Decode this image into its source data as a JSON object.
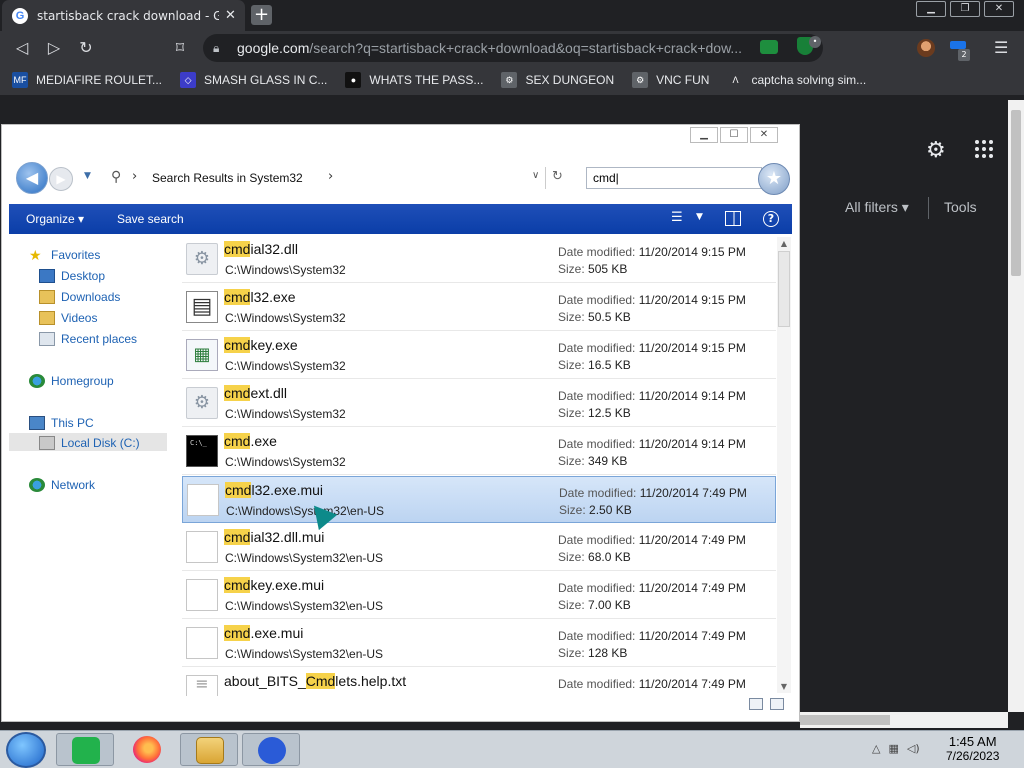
{
  "browser": {
    "tab_title": "startisback crack download - Goog",
    "url_host": "google.com",
    "url_path": "/search?q=startisback+crack+download&oq=startisback+crack+dow...",
    "extension_badge": "2",
    "bookmarks": [
      {
        "label": "MEDIAFIRE ROULET...",
        "icon": "MF",
        "color": "#1a4fa0"
      },
      {
        "label": "SMASH GLASS IN C...",
        "icon": "◇",
        "color": "#3c3cc8"
      },
      {
        "label": "WHATS THE PASS...",
        "icon": "●",
        "color": "#111111"
      },
      {
        "label": "SEX DUNGEON",
        "icon": "⚙",
        "color": "#5f6368"
      },
      {
        "label": "VNC FUN",
        "icon": "⚙",
        "color": "#5f6368"
      },
      {
        "label": "captcha solving sim...",
        "icon": "Λ",
        "color": "#35363a"
      }
    ]
  },
  "google": {
    "all_filters": "All filters ▾",
    "tools": "Tools"
  },
  "explorer": {
    "breadcrumb": "Search Results in System32",
    "search_value": "cmd",
    "toolbar": {
      "organize": "Organize ▾",
      "save_search": "Save search"
    },
    "nav": {
      "favorites": "Favorites",
      "desktop": "Desktop",
      "downloads": "Downloads",
      "videos": "Videos",
      "recent_places": "Recent places",
      "homegroup": "Homegroup",
      "this_pc": "This PC",
      "local_disk": "Local Disk (C:)",
      "network": "Network"
    },
    "labels": {
      "date_modified": "Date modified:",
      "size": "Size:"
    },
    "files": [
      {
        "hl": "cmd",
        "rest": "ial32.dll",
        "path": "C:\\Windows\\System32",
        "date": "11/20/2014 9:15 PM",
        "size": "505 KB",
        "icon": "dll"
      },
      {
        "hl": "cmd",
        "rest": "l32.exe",
        "path": "C:\\Windows\\System32",
        "date": "11/20/2014 9:15 PM",
        "size": "50.5 KB",
        "icon": "cmdl"
      },
      {
        "hl": "cmd",
        "rest": "key.exe",
        "path": "C:\\Windows\\System32",
        "date": "11/20/2014 9:15 PM",
        "size": "16.5 KB",
        "icon": "key"
      },
      {
        "hl": "cmd",
        "rest": "ext.dll",
        "path": "C:\\Windows\\System32",
        "date": "11/20/2014 9:14 PM",
        "size": "12.5 KB",
        "icon": "dll"
      },
      {
        "hl": "cmd",
        "rest": ".exe",
        "path": "C:\\Windows\\System32",
        "date": "11/20/2014 9:14 PM",
        "size": "349 KB",
        "icon": "cmd"
      },
      {
        "hl": "cmd",
        "rest": "l32.exe.mui",
        "path": "C:\\Windows\\System32\\en-US",
        "date": "11/20/2014 7:49 PM",
        "size": "2.50 KB",
        "icon": "doc",
        "selected": true
      },
      {
        "hl": "cmd",
        "rest": "ial32.dll.mui",
        "path": "C:\\Windows\\System32\\en-US",
        "date": "11/20/2014 7:49 PM",
        "size": "68.0 KB",
        "icon": "doc"
      },
      {
        "hl": "cmd",
        "rest": "key.exe.mui",
        "path": "C:\\Windows\\System32\\en-US",
        "date": "11/20/2014 7:49 PM",
        "size": "7.00 KB",
        "icon": "doc"
      },
      {
        "hl": "cmd",
        "rest": ".exe.mui",
        "path": "C:\\Windows\\System32\\en-US",
        "date": "11/20/2014 7:49 PM",
        "size": "128 KB",
        "icon": "doc"
      },
      {
        "pre": "about_BITS_",
        "hl": "Cmd",
        "rest": "lets.help.txt",
        "path": "",
        "date": "11/20/2014 7:49 PM",
        "size": "",
        "icon": "txt"
      }
    ]
  },
  "taskbar": {
    "time": "1:45 AM",
    "date": "7/26/2023"
  }
}
